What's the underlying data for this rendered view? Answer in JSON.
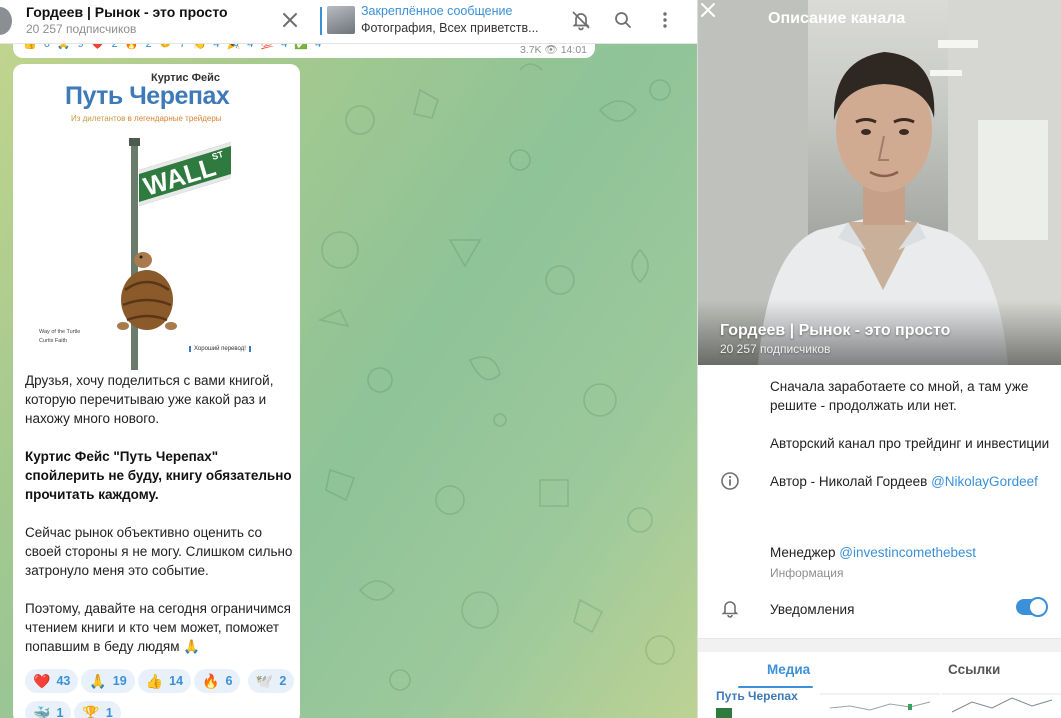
{
  "header": {
    "title": "Гордеев | Рынок - это просто",
    "subscribers": "20 257 подписчиков",
    "pinned_label": "Закреплённое сообщение",
    "pinned_text": "Фотография, Всех приветств..."
  },
  "prev_message": {
    "views": "3.7K",
    "time": "14:01"
  },
  "post": {
    "book": {
      "author": "Куртис Фейс",
      "title": "Путь Черепах",
      "subtitle_start": "Из дилетантов ",
      "subtitle_highlight": "в легендарные трейдеры",
      "sign": "WALL",
      "sign_suffix": "ST",
      "footer_left_1": "Way of the Turtle",
      "footer_left_2": "Curtis Faith",
      "footer_right": "Хороший перевод!"
    },
    "paragraph1": "Друзья, хочу поделиться с вами книгой, которую перечитываю уже какой раз и нахожу много нового.",
    "paragraph2_line1": "Куртис Фейс \"Путь Черепах\"",
    "paragraph2_line2": "спойлерить не буду, книгу обязательно прочитать каждому.",
    "paragraph3": "Сейчас рынок объективно оценить со своей стороны я не могу. Слишком сильно затронуло меня это событие.",
    "paragraph4": "Поэтому, давайте на сегодня ограничимся чтением книги и кто чем может, поможет попавшим в беду людям 🙏",
    "reactions": [
      {
        "emoji": "❤️",
        "count": "43"
      },
      {
        "emoji": "🙏",
        "count": "19"
      },
      {
        "emoji": "👍",
        "count": "14"
      },
      {
        "emoji": "🔥",
        "count": "6"
      },
      {
        "emoji": "🕊️",
        "count": "2"
      },
      {
        "emoji": "🐳",
        "count": "1"
      },
      {
        "emoji": "🏆",
        "count": "1"
      }
    ]
  },
  "channel_info": {
    "panel_title": "Описание канала",
    "name": "Гордеев | Рынок - это просто",
    "subscribers": "20 257 подписчиков",
    "desc1": "Сначала заработаете со мной, а там уже решите - продолжать или нет.",
    "desc2": "Авторский канал про трейдинг и инвестиции",
    "author_prefix": "Автор - Николай Гордеев ",
    "author_link": "@NikolayGordeef",
    "manager_prefix": "Менеджер ",
    "manager_link": "@investincomethebest",
    "info_caption": "Информация",
    "notifications_label": "Уведомления",
    "notifications_on": true,
    "tab_media": "Медиа",
    "tab_links": "Ссылки",
    "thumb1_text": "Путь Черепах"
  },
  "colors": {
    "accent": "#3a90d9",
    "book_title": "#3e79b8",
    "chat_bg": "#9cc99c"
  }
}
